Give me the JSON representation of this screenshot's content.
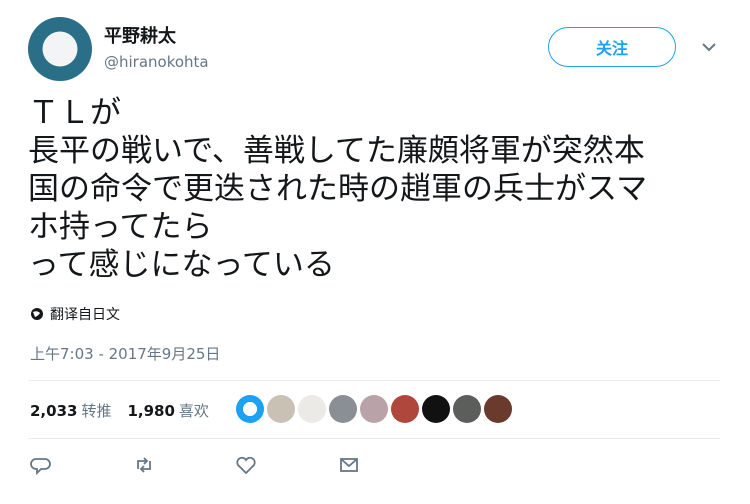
{
  "user": {
    "display_name": "平野耕太",
    "handle": "@hiranokohta"
  },
  "follow_label": "关注",
  "tweet": {
    "lines": [
      "ＴＬが",
      "長平の戦いで、善戦してた廉頗将軍が突然本",
      "国の命令で更迭された時の趙軍の兵士がスマ",
      "ホ持ってたら",
      "って感じになっている"
    ]
  },
  "translate_label": "翻译自日文",
  "timestamp": "上午7:03 - 2017年9月25日",
  "stats": {
    "retweets_count": "2,033",
    "retweets_label": "转推",
    "likes_count": "1,980",
    "likes_label": "喜欢"
  },
  "colors": {
    "accent": "#1da1f2",
    "secondary_text": "#657786",
    "divider": "#e6ecf0"
  },
  "icons": [
    "chevron-down-icon",
    "globe-icon",
    "reply-icon",
    "retweet-icon",
    "like-icon",
    "message-icon"
  ]
}
